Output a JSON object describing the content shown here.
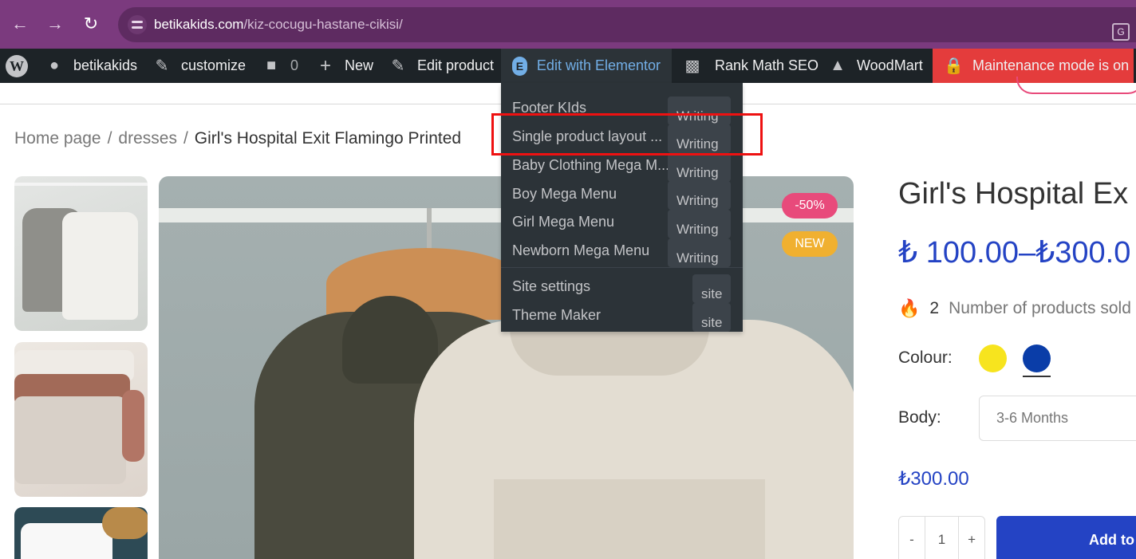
{
  "browser": {
    "url_host": "betikakids.com",
    "url_path": "/kiz-cocugu-hastane-cikisi/"
  },
  "adminbar": {
    "site_name": "betikakids",
    "customize": "customize",
    "comments_count": "0",
    "new": "New",
    "edit_product": "Edit product",
    "edit_elementor": "Edit with Elementor",
    "rank_math": "Rank Math SEO",
    "woodmart": "WoodMart",
    "maintenance": "Maintenance mode is on"
  },
  "elementor_menu": {
    "items": [
      {
        "label": "Footer KIds",
        "tag": "Writing"
      },
      {
        "label": "Single product layout ...",
        "tag": "Writing"
      },
      {
        "label": "Baby Clothing Mega M...",
        "tag": "Writing"
      },
      {
        "label": "Boy Mega Menu",
        "tag": "Writing"
      },
      {
        "label": "Girl Mega Menu",
        "tag": "Writing"
      },
      {
        "label": "Newborn Mega Menu",
        "tag": "Writing"
      }
    ],
    "site_items": [
      {
        "label": "Site settings",
        "tag": "site"
      },
      {
        "label": "Theme Maker",
        "tag": "site"
      }
    ]
  },
  "breadcrumb": {
    "home": "Home page",
    "sep": "/",
    "category": "dresses",
    "current": "Girl's Hospital Exit Flamingo Printed"
  },
  "product": {
    "title": "Girl's Hospital Ex",
    "price": "₺ 100.00–₺300.0",
    "sold_count": "2",
    "sold_text": "Number of products sold",
    "colour_label": "Colour:",
    "body_label": "Body:",
    "body_value": "3-6 Months",
    "variation_price": "₺300.00",
    "qty_minus": "-",
    "qty_value": "1",
    "qty_plus": "+",
    "add_to_cart": "Add to",
    "badge_sale": "-50%",
    "badge_new": "NEW",
    "swatches": [
      "#f7e41e",
      "#0a3da8"
    ]
  }
}
